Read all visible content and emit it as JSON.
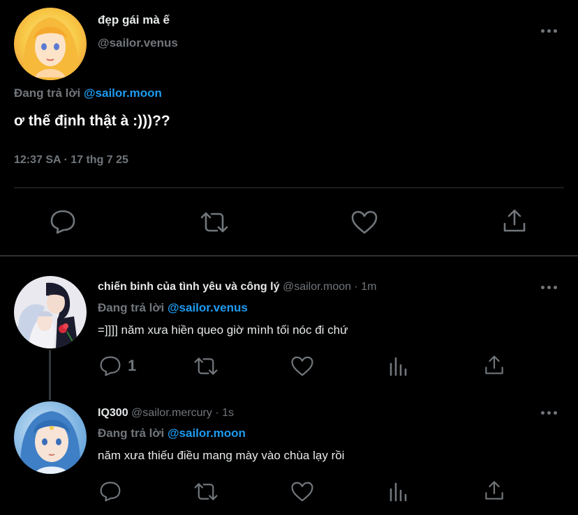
{
  "main_tweet": {
    "display_name": "đẹp gái mà ế",
    "handle": "@sailor.venus",
    "replying_prefix": "Đang trả lời",
    "replying_to": "@sailor.moon",
    "text": "ơ thế định thật à :)))??",
    "timestamp": "12:37 SA · 17 thg 7 25",
    "actions": [
      "reply-icon",
      "retweet-icon",
      "like-icon",
      "share-icon"
    ]
  },
  "replies": [
    {
      "display_name": "chiến binh của tình yêu và công lý",
      "handle": "@sailor.moon",
      "separator": "·",
      "time": "1m",
      "replying_prefix": "Đang trả lời",
      "replying_to": "@sailor.venus",
      "text": "=]]]] năm xưa hiền queo giờ mình tối nóc đi chứ",
      "reply_count": "1",
      "actions": [
        "reply-icon",
        "retweet-icon",
        "like-icon",
        "analytics-icon",
        "share-icon"
      ]
    },
    {
      "display_name": "IQ300",
      "handle": "@sailor.mercury",
      "separator": "·",
      "time": "1s",
      "replying_prefix": "Đang trả lời",
      "replying_to": "@sailor.moon",
      "text": "năm xưa thiếu điều mang mày vào chùa lạy rồi",
      "actions": [
        "reply-icon",
        "retweet-icon",
        "like-icon",
        "analytics-icon",
        "share-icon"
      ]
    }
  ],
  "colors": {
    "background": "#000000",
    "text": "#e7e9ea",
    "muted": "#71767b",
    "link": "#1d9bf0",
    "divider": "#2f3336"
  }
}
